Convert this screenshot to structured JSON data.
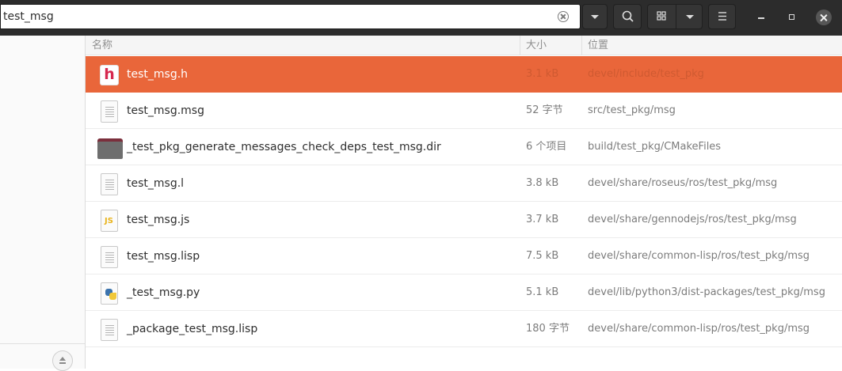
{
  "search": {
    "value": "test_msg"
  },
  "columns": {
    "name": "名称",
    "size": "大小",
    "location": "位置"
  },
  "files": [
    {
      "name": "test_msg.h",
      "size": "3.1 kB",
      "location": "devel/include/test_pkg",
      "icon": "c-header-file-icon",
      "selected": true
    },
    {
      "name": "test_msg.msg",
      "size": "52 字节",
      "location": "src/test_pkg/msg",
      "icon": "text-file-icon",
      "selected": false
    },
    {
      "name": "_test_pkg_generate_messages_check_deps_test_msg.dir",
      "size": "6 个项目",
      "location": "build/test_pkg/CMakeFiles",
      "icon": "folder-icon",
      "selected": false
    },
    {
      "name": "test_msg.l",
      "size": "3.8 kB",
      "location": "devel/share/roseus/ros/test_pkg/msg",
      "icon": "text-file-icon",
      "selected": false
    },
    {
      "name": "test_msg.js",
      "size": "3.7 kB",
      "location": "devel/share/gennodejs/ros/test_pkg/msg",
      "icon": "javascript-file-icon",
      "selected": false
    },
    {
      "name": "test_msg.lisp",
      "size": "7.5 kB",
      "location": "devel/share/common-lisp/ros/test_pkg/msg",
      "icon": "text-file-icon",
      "selected": false
    },
    {
      "name": "_test_msg.py",
      "size": "5.1 kB",
      "location": "devel/lib/python3/dist-packages/test_pkg/msg",
      "icon": "python-file-icon",
      "selected": false
    },
    {
      "name": "_package_test_msg.lisp",
      "size": "180 字节",
      "location": "devel/share/common-lisp/ros/test_pkg/msg",
      "icon": "text-file-icon",
      "selected": false
    }
  ],
  "icons": {
    "js_glyph": "JS",
    "header_glyph": "h"
  },
  "colors": {
    "selection": "#e9663a",
    "header_bar": "#2c2c2c"
  }
}
